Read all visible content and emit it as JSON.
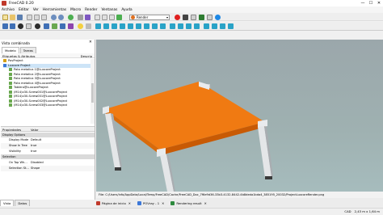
{
  "window": {
    "title": "FreeCAD 0.20",
    "controls": [
      "—",
      "☐",
      "✕"
    ]
  },
  "menu": [
    "Archivo",
    "Editar",
    "Ver",
    "Herramientas",
    "Macro",
    "Render",
    "Ventanas",
    "Ayuda"
  ],
  "workbench": {
    "selected": "Render"
  },
  "left_panel": {
    "title": "Vista combinada",
    "tabs": [
      "Modelo",
      "Tareas"
    ],
    "tree_header": {
      "labels": "Etiquetas & Atributos",
      "description": "Descrip"
    },
    "tree_items": [
      {
        "label": "Etiquetas & Atributos",
        "icon_color": "#888888"
      },
      {
        "label": "PovProject",
        "icon_color": "#d4a017"
      },
      {
        "label": "Luxcore Project",
        "icon_color": "#3c78d8"
      },
      {
        "label": "Pata metalica 1@LuxcoreProject",
        "icon_color": "#6aa84f"
      },
      {
        "label": "Pata metalica 2@LuxcoreProject",
        "icon_color": "#6aa84f"
      },
      {
        "label": "Pata metalica 3@LuxcoreProject",
        "icon_color": "#6aa84f"
      },
      {
        "label": "Pata metalica 4@LuxcoreProject",
        "icon_color": "#6aa84f"
      },
      {
        "label": "Tablero@LuxcoreProject",
        "icon_color": "#6aa84f"
      },
      {
        "label": "(M14)x30-Screw001@LuxcoreProject",
        "icon_color": "#6aa84f"
      },
      {
        "label": "(M14)x30-Screw001@LuxcoreProject",
        "icon_color": "#6aa84f"
      },
      {
        "label": "(M14)x30-Screw002@LuxcoreProject",
        "icon_color": "#6aa84f"
      },
      {
        "label": "(M14)x30-Screw003@LuxcoreProject",
        "icon_color": "#6aa84f"
      }
    ],
    "properties": {
      "header": {
        "name": "Propiedades",
        "value": "Valor"
      },
      "groups": [
        {
          "name": "Display Options",
          "rows": [
            {
              "key": "Display Mode",
              "value": "Default"
            },
            {
              "key": "Show In Tree",
              "value": "true"
            },
            {
              "key": "Visibility",
              "value": "true"
            }
          ]
        },
        {
          "name": "Selection",
          "rows": [
            {
              "key": "On Top Wh...",
              "value": "Disabled"
            },
            {
              "key": "Selection St...",
              "value": "Shape"
            }
          ]
        }
      ]
    },
    "bottom_tabs": [
      "Vista",
      "Datos"
    ]
  },
  "viewport": {
    "file_path": "File: C:/Users/info/AppData/Local/Temp/FreeCAD/Cache/FreeCAD_Doc_7f6e9d36-33b3-4132-8442-4b8deda1bda4_385195_20032/ProjectLuxcoreRender.png",
    "colors": {
      "tabletop": "#f07a12",
      "tabletop_dark": "#c85a04",
      "legs": "#e4e6e8",
      "legs_shade": "#a9adb1",
      "feet": "#3a3a3a"
    }
  },
  "doc_tabs": [
    {
      "label": "Página de inicio",
      "icon_color": "#c0392b"
    },
    {
      "label": "POVray - 1",
      "icon_color": "#3c78d8"
    },
    {
      "label": "Rendering result",
      "icon_color": "#2d8a3e"
    }
  ],
  "status_bar": {
    "workbench": "CAD",
    "dimensions": "2,43 m x 1,64 m"
  }
}
